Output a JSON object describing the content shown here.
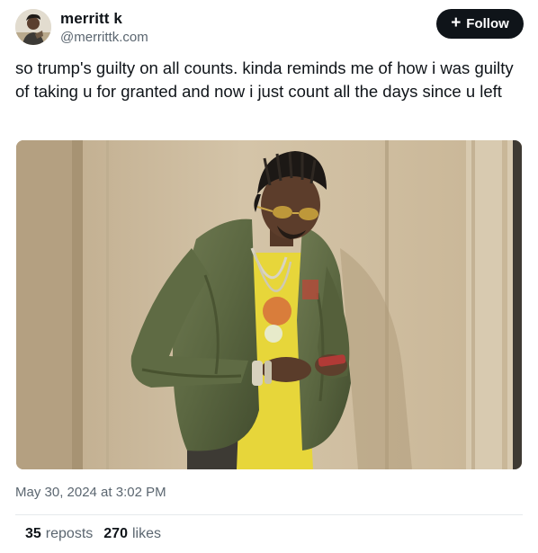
{
  "author": {
    "display_name": "merritt k",
    "handle": "@merrittk.com",
    "avatar_icon": "user-avatar-photo"
  },
  "follow_button": {
    "label": "Follow",
    "icon": "plus-icon"
  },
  "post": {
    "text": "so trump's guilty on all counts. kinda reminds me of how i was guilty of taking u for granted and now i just count all the days since u left",
    "timestamp": "May 30, 2024 at 3:02 PM"
  },
  "stats": {
    "reposts_count": "35",
    "reposts_label": "reposts",
    "likes_count": "270",
    "likes_label": "likes"
  },
  "colors": {
    "text_primary": "#0f1419",
    "text_secondary": "#5b6670",
    "follow_button_bg": "#0f1419",
    "divider": "#e6e9ec"
  }
}
